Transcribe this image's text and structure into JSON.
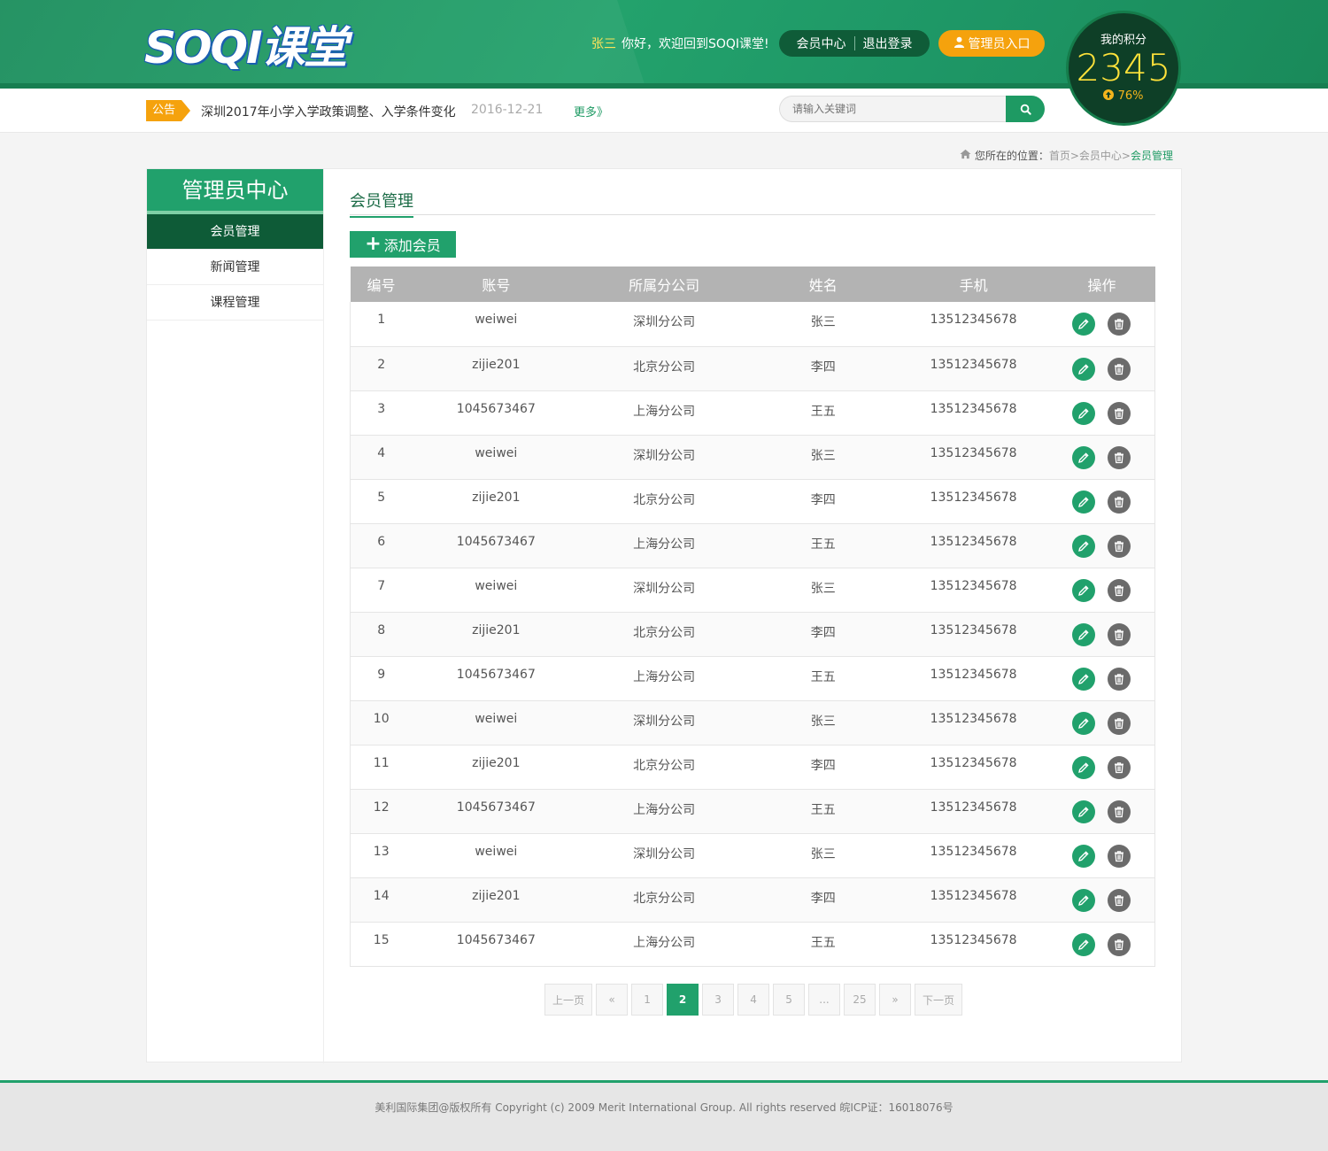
{
  "header": {
    "logo_text": "SOQI课堂",
    "user_name": "张三",
    "greeting": "你好，欢迎回到SOQI课堂!",
    "member_center": "会员中心",
    "logout": "退出登录",
    "admin_entry": "管理员入口",
    "score_label": "我的积分",
    "score_value": "2345",
    "score_percent": "76%"
  },
  "notice": {
    "tag": "公告",
    "text": "深圳2017年小学入学政策调整、入学条件变化",
    "date": "2016-12-21",
    "more": "更多》"
  },
  "search": {
    "placeholder": "请输入关键词"
  },
  "breadcrumb": {
    "prefix": "您所在的位置：",
    "home": "首页",
    "sep1": ">",
    "member": "会员中心",
    "sep2": ">",
    "current": "会员管理"
  },
  "sidebar": {
    "title": "管理员中心",
    "items": [
      {
        "label": "会员管理"
      },
      {
        "label": "新闻管理"
      },
      {
        "label": "课程管理"
      }
    ]
  },
  "main": {
    "title": "会员管理",
    "add_button": "添加会员",
    "columns": [
      "编号",
      "账号",
      "所属分公司",
      "姓名",
      "手机",
      "操作"
    ],
    "rows": [
      [
        "1",
        "weiwei",
        "深圳分公司",
        "张三",
        "13512345678"
      ],
      [
        "2",
        "zijie201",
        "北京分公司",
        "李四",
        "13512345678"
      ],
      [
        "3",
        "1045673467",
        "上海分公司",
        "王五",
        "13512345678"
      ],
      [
        "4",
        "weiwei",
        "深圳分公司",
        "张三",
        "13512345678"
      ],
      [
        "5",
        "zijie201",
        "北京分公司",
        "李四",
        "13512345678"
      ],
      [
        "6",
        "1045673467",
        "上海分公司",
        "王五",
        "13512345678"
      ],
      [
        "7",
        "weiwei",
        "深圳分公司",
        "张三",
        "13512345678"
      ],
      [
        "8",
        "zijie201",
        "北京分公司",
        "李四",
        "13512345678"
      ],
      [
        "9",
        "1045673467",
        "上海分公司",
        "王五",
        "13512345678"
      ],
      [
        "10",
        "weiwei",
        "深圳分公司",
        "张三",
        "13512345678"
      ],
      [
        "11",
        "zijie201",
        "北京分公司",
        "李四",
        "13512345678"
      ],
      [
        "12",
        "1045673467",
        "上海分公司",
        "王五",
        "13512345678"
      ],
      [
        "13",
        "weiwei",
        "深圳分公司",
        "张三",
        "13512345678"
      ],
      [
        "14",
        "zijie201",
        "北京分公司",
        "李四",
        "13512345678"
      ],
      [
        "15",
        "1045673467",
        "上海分公司",
        "王五",
        "13512345678"
      ]
    ]
  },
  "pagination": {
    "items": [
      "上一页",
      "«",
      "1",
      "2",
      "3",
      "4",
      "5",
      "...",
      "25",
      "»",
      "下一页"
    ],
    "current": "2"
  },
  "footer": {
    "text": "美利国际集团@版权所有  Copyright (c) 2009 Merit International Group. All rights reserved  皖ICP证：16018076号"
  },
  "colors": {
    "brand_green": "#21a16c",
    "dark_green": "#0e5b37",
    "accent_orange": "#f5a20d",
    "score_yellow": "#ffe23a"
  }
}
